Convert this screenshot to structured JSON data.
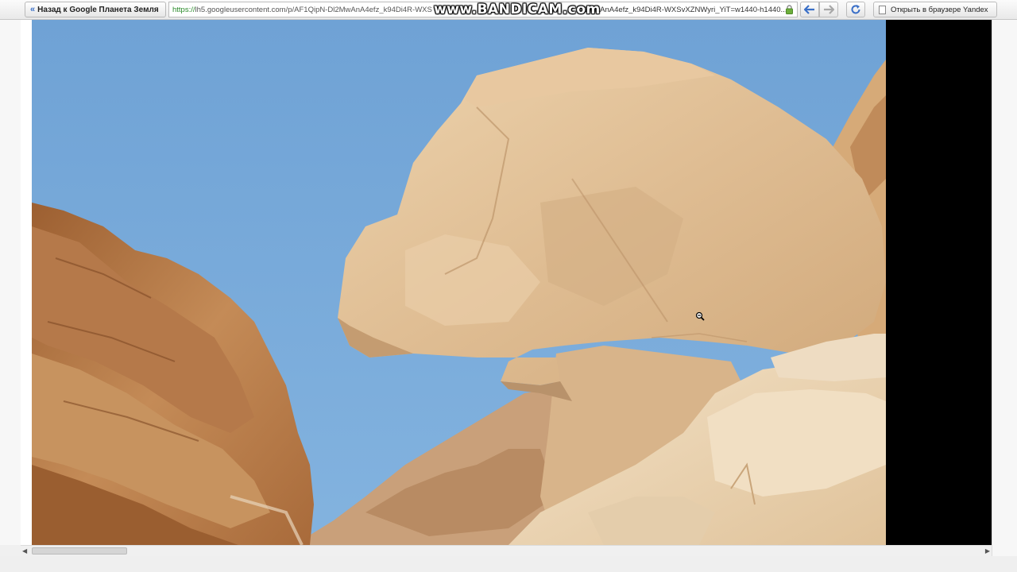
{
  "toolbar": {
    "back_label": "Назад к Google Планета Земля",
    "back_chevron": "«",
    "url_scheme": "https://",
    "url_left": "lh5.googleusercontent.com/p/AF1QipN-Dl2MwAnA4efz_k94Di4R-WXS",
    "url_right": "l2MwAnA4efz_k94Di4R-WXSvXZNWyri_YiT=w1440-h1440...",
    "open_in_browser_label": "Открыть в браузере Yandex"
  },
  "watermark": "www.BANDICAM.com",
  "icons": {
    "back": "back-arrow-icon",
    "forward": "forward-arrow-icon",
    "reload": "reload-icon",
    "lock": "lock-icon",
    "zoom_cursor": "zoom-out-cursor-icon"
  },
  "colors": {
    "sky": "#74a6d6",
    "rock_light": "#e3c49c",
    "rock_dark": "#b07542",
    "toolbar_bg": "#efefef",
    "accent_blue": "#3a6fc7"
  }
}
